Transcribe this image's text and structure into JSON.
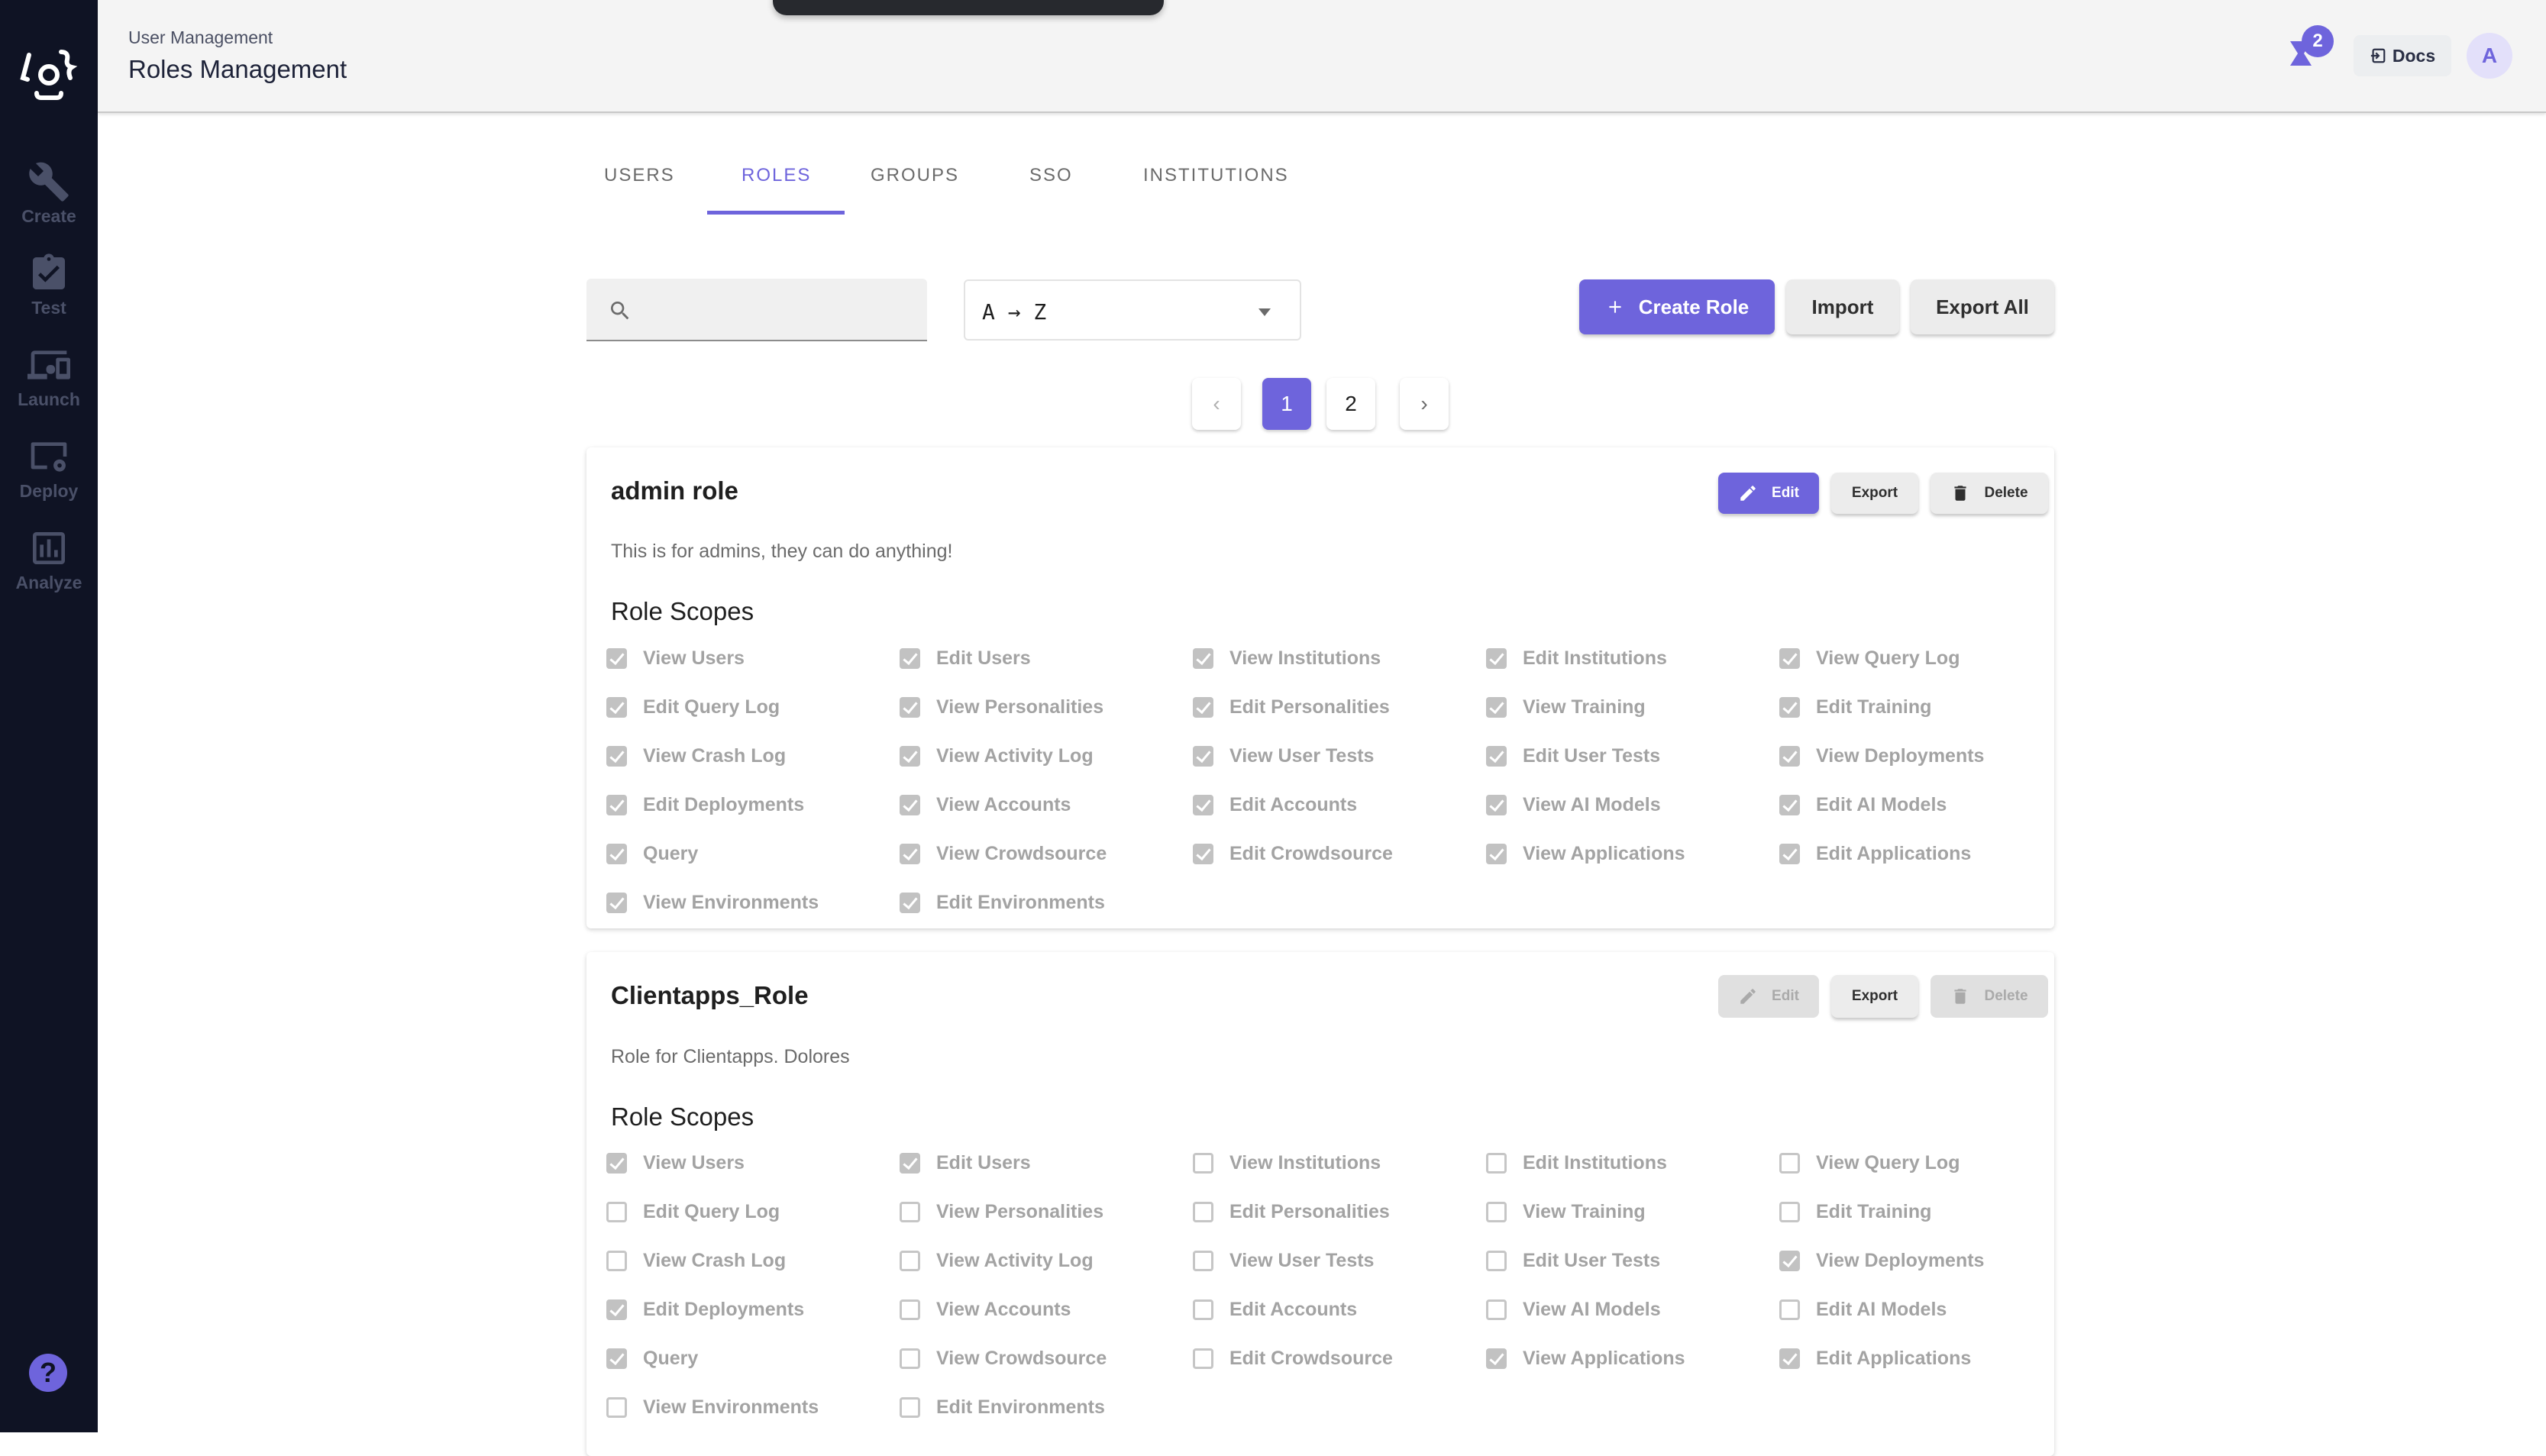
{
  "sidebar": {
    "items": [
      {
        "label": "Create",
        "icon": "wrench-icon"
      },
      {
        "label": "Test",
        "icon": "clipboard-check-icon"
      },
      {
        "label": "Launch",
        "icon": "devices-icon"
      },
      {
        "label": "Deploy",
        "icon": "screen-gear-icon"
      },
      {
        "label": "Analyze",
        "icon": "bar-chart-icon"
      }
    ],
    "help_label": "?"
  },
  "header": {
    "breadcrumb": "User Management",
    "title": "Roles Management",
    "notification_count": "2",
    "docs_label": "Docs",
    "avatar_initial": "A"
  },
  "tabs": [
    {
      "label": "USERS",
      "active": false
    },
    {
      "label": "ROLES",
      "active": true
    },
    {
      "label": "GROUPS",
      "active": false
    },
    {
      "label": "SSO",
      "active": false
    },
    {
      "label": "INSTITUTIONS",
      "active": false
    }
  ],
  "toolbar": {
    "search_value": "",
    "search_placeholder": "",
    "sort_value": "A → Z",
    "create_label": "Create Role",
    "import_label": "Import",
    "export_all_label": "Export All"
  },
  "pagination": {
    "pages": [
      "1",
      "2"
    ],
    "current": "1",
    "prev_enabled": false,
    "next_enabled": true
  },
  "roles": [
    {
      "name": "admin role",
      "description": "This is for admins, they can do anything!",
      "scopes_heading": "Role Scopes",
      "edit_label": "Edit",
      "export_label": "Export",
      "delete_label": "Delete",
      "actions_enabled": true,
      "scopes": [
        {
          "label": "View Users",
          "checked": true
        },
        {
          "label": "Edit Users",
          "checked": true
        },
        {
          "label": "View Institutions",
          "checked": true
        },
        {
          "label": "Edit Institutions",
          "checked": true
        },
        {
          "label": "View Query Log",
          "checked": true
        },
        {
          "label": "Edit Query Log",
          "checked": true
        },
        {
          "label": "View Personalities",
          "checked": true
        },
        {
          "label": "Edit Personalities",
          "checked": true
        },
        {
          "label": "View Training",
          "checked": true
        },
        {
          "label": "Edit Training",
          "checked": true
        },
        {
          "label": "View Crash Log",
          "checked": true
        },
        {
          "label": "View Activity Log",
          "checked": true
        },
        {
          "label": "View User Tests",
          "checked": true
        },
        {
          "label": "Edit User Tests",
          "checked": true
        },
        {
          "label": "View Deployments",
          "checked": true
        },
        {
          "label": "Edit Deployments",
          "checked": true
        },
        {
          "label": "View Accounts",
          "checked": true
        },
        {
          "label": "Edit Accounts",
          "checked": true
        },
        {
          "label": "View AI Models",
          "checked": true
        },
        {
          "label": "Edit AI Models",
          "checked": true
        },
        {
          "label": "Query",
          "checked": true
        },
        {
          "label": "View Crowdsource",
          "checked": true
        },
        {
          "label": "Edit Crowdsource",
          "checked": true
        },
        {
          "label": "View Applications",
          "checked": true
        },
        {
          "label": "Edit Applications",
          "checked": true
        },
        {
          "label": "View Environments",
          "checked": true
        },
        {
          "label": "Edit Environments",
          "checked": true
        }
      ]
    },
    {
      "name": "Clientapps_Role",
      "description": "Role for Clientapps. Dolores",
      "scopes_heading": "Role Scopes",
      "edit_label": "Edit",
      "export_label": "Export",
      "delete_label": "Delete",
      "actions_enabled": false,
      "scopes": [
        {
          "label": "View Users",
          "checked": true
        },
        {
          "label": "Edit Users",
          "checked": true
        },
        {
          "label": "View Institutions",
          "checked": false
        },
        {
          "label": "Edit Institutions",
          "checked": false
        },
        {
          "label": "View Query Log",
          "checked": false
        },
        {
          "label": "Edit Query Log",
          "checked": false
        },
        {
          "label": "View Personalities",
          "checked": false
        },
        {
          "label": "Edit Personalities",
          "checked": false
        },
        {
          "label": "View Training",
          "checked": false
        },
        {
          "label": "Edit Training",
          "checked": false
        },
        {
          "label": "View Crash Log",
          "checked": false
        },
        {
          "label": "View Activity Log",
          "checked": false
        },
        {
          "label": "View User Tests",
          "checked": false
        },
        {
          "label": "Edit User Tests",
          "checked": false
        },
        {
          "label": "View Deployments",
          "checked": true
        },
        {
          "label": "Edit Deployments",
          "checked": true
        },
        {
          "label": "View Accounts",
          "checked": false
        },
        {
          "label": "Edit Accounts",
          "checked": false
        },
        {
          "label": "View AI Models",
          "checked": false
        },
        {
          "label": "Edit AI Models",
          "checked": false
        },
        {
          "label": "Query",
          "checked": true
        },
        {
          "label": "View Crowdsource",
          "checked": false
        },
        {
          "label": "Edit Crowdsource",
          "checked": false
        },
        {
          "label": "View Applications",
          "checked": true
        },
        {
          "label": "Edit Applications",
          "checked": true
        },
        {
          "label": "View Environments",
          "checked": false
        },
        {
          "label": "Edit Environments",
          "checked": false
        }
      ]
    }
  ],
  "colors": {
    "accent": "#6e64dc",
    "sidebar_bg": "#0f1324",
    "header_bg": "#f4f4f4"
  }
}
